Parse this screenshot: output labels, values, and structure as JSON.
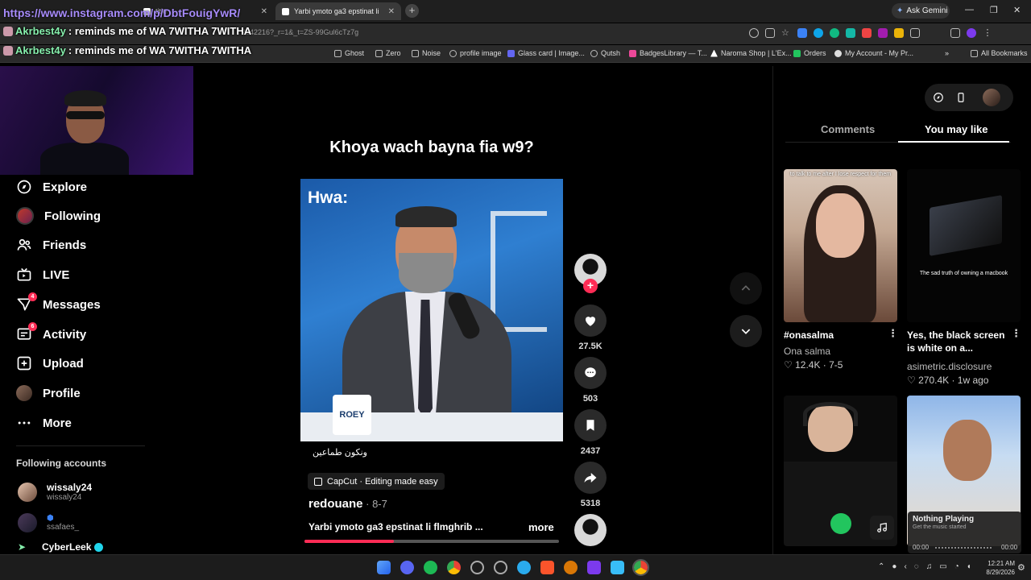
{
  "browser": {
    "tabs": [
      {
        "label": "title"
      },
      {
        "label": "Yarbi ymoto ga3 epstinat li"
      }
    ],
    "new_tab": "+",
    "ask_gemini": "Ask Gemini",
    "url": "2942216?_r=1&_t=ZS-99Gul6cTz7g",
    "bookmarks": [
      "Ghost",
      "Zero",
      "Noise",
      "profile image",
      "Glass card | Image...",
      "Qutsh",
      "BadgesLibrary — T...",
      "Naroma Shop | L'Ex...",
      "Orders",
      "My Account - My Pr...",
      "All Bookmarks"
    ]
  },
  "overlay": {
    "url": "https://www.instagram.com/p/DbtFouigYwR/",
    "chat": [
      {
        "user": "Akrbest4y",
        "message": ": reminds me of WA 7WITHA 7WITHA"
      },
      {
        "user": "Akrbest4y",
        "message": ": reminds me of WA 7WITHA 7WITHA"
      }
    ]
  },
  "sidebar": {
    "items": [
      {
        "label": "Explore",
        "icon": "compass-icon"
      },
      {
        "label": "Following",
        "icon": "avatar"
      },
      {
        "label": "Friends",
        "icon": "friends-icon"
      },
      {
        "label": "LIVE",
        "icon": "live-icon"
      },
      {
        "label": "Messages",
        "icon": "paper-plane-icon",
        "badge": "4"
      },
      {
        "label": "Activity",
        "icon": "inbox-icon",
        "badge": "6"
      },
      {
        "label": "Upload",
        "icon": "plus-square-icon"
      },
      {
        "label": "Profile",
        "icon": "avatar"
      },
      {
        "label": "More",
        "icon": "ellipsis-icon"
      }
    ],
    "following_title": "Following accounts",
    "accounts": [
      {
        "name": "wissaly24",
        "handle": "wissaly24"
      },
      {
        "name": "",
        "handle": "ssafaes_"
      },
      {
        "name": "CyberLeek",
        "handle": ""
      }
    ]
  },
  "video": {
    "title": "Khoya wach bayna fia w9?",
    "overlay_text": "Hwa:",
    "mug_text": "ROEY",
    "caption": "ونكون طماعين",
    "capcut": "CapCut · Editing made easy",
    "author": "redouane",
    "date": " · 8-7",
    "description": "Yarbi ymoto ga3 epstinat li flmghrib ...",
    "more": "more",
    "progress": 0.35,
    "likes": "27.5K",
    "comments": "503",
    "saves": "2437",
    "shares": "5318"
  },
  "right_panel": {
    "tabs": [
      "Comments",
      "You may like"
    ],
    "active_tab": "You may like",
    "cards": [
      {
        "thumb_caption": "to talk to me after I lose respect for them",
        "title": "#onasalma",
        "user": "Ona salma",
        "stats": "♡ 12.4K · 7-5"
      },
      {
        "thumb_caption": "The sad truth of owning a macbook",
        "title": "Yes, the black screen is white on a...",
        "user": "asimetric.disclosure",
        "stats": "♡ 270.4K · 1w ago"
      }
    ],
    "now_playing": {
      "title": "Nothing Playing",
      "subtitle": "Get the music started",
      "start": "00:00",
      "end": "00:00"
    }
  },
  "taskbar": {
    "time": "12:21 AM",
    "date": "8/29/2026"
  },
  "colors": {
    "accent": "#fe2c55",
    "chat_user": "#86efac",
    "overlay_url": "#a78bfa"
  }
}
